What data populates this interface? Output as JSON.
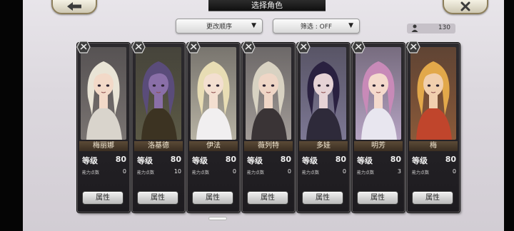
{
  "header": {
    "title": "选择角色",
    "back_icon": "back-arrow-icon",
    "close_icon": "close-x-icon"
  },
  "controls": {
    "sort_label": "更改顺序",
    "filter_label": "筛选 : OFF",
    "character_count": "130"
  },
  "card_labels": {
    "level": "等级",
    "ability_points": "能力点数",
    "attr_button": "属性"
  },
  "characters": [
    {
      "name": "梅丽娜",
      "level": "80",
      "ability_points": "0",
      "hair": "#e9e4d6",
      "skin": "#f2d9c8",
      "outfit": "#d9d4cc",
      "bg": "#7a7472"
    },
    {
      "name": "洛基德",
      "level": "80",
      "ability_points": "10",
      "hair": "#5a4c7a",
      "skin": "#8a6fa8",
      "outfit": "#3c3322",
      "bg": "#5c5a46"
    },
    {
      "name": "伊法",
      "level": "80",
      "ability_points": "0",
      "hair": "#e8ddb4",
      "skin": "#f3dfd0",
      "outfit": "#f1eff0",
      "bg": "#b7b2a3"
    },
    {
      "name": "薇列特",
      "level": "80",
      "ability_points": "0",
      "hair": "#d8d2c2",
      "skin": "#efd6c6",
      "outfit": "#3a3436",
      "bg": "#a29c98"
    },
    {
      "name": "多娃",
      "level": "80",
      "ability_points": "0",
      "hair": "#2a2140",
      "skin": "#e6d3d6",
      "outfit": "#2e2a3a",
      "bg": "#7d7894"
    },
    {
      "name": "明芳",
      "level": "80",
      "ability_points": "3",
      "hair": "#c88ab8",
      "skin": "#f4d9cc",
      "outfit": "#e8e6ef",
      "bg": "#b5a3c2"
    },
    {
      "name": "梅",
      "level": "80",
      "ability_points": "0",
      "hair": "#e2a84a",
      "skin": "#f1cfae",
      "outfit": "#c0452c",
      "bg": "#8a5a3a"
    }
  ]
}
